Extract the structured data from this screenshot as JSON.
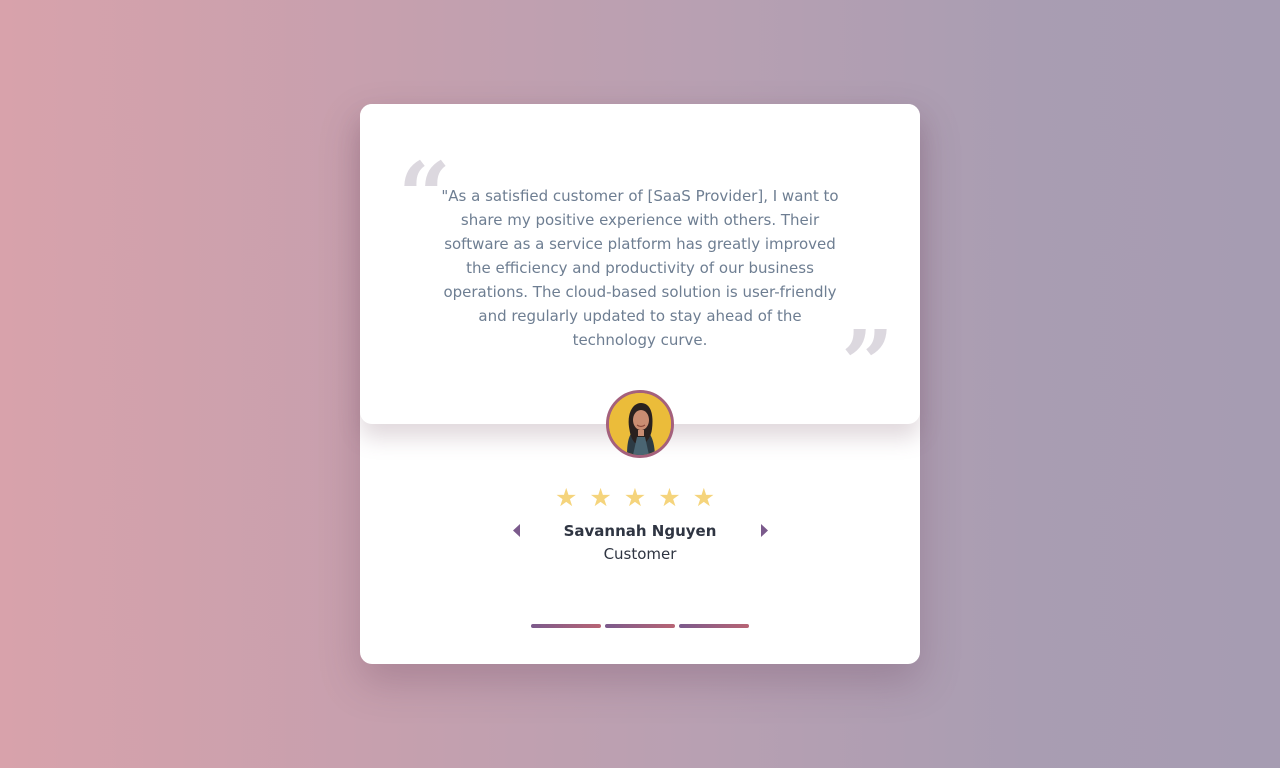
{
  "testimonial": {
    "quote_open": "“",
    "quote_close": "”",
    "text": "\"As a satisfied customer of [SaaS Provider], I want to share my positive experience with others. Their software as a service platform has greatly improved the efficiency and productivity of our business operations. The cloud-based solution is user-friendly and regularly updated to stay ahead of the technology curve.",
    "rating": 5,
    "star_glyph": "★",
    "name": "Savannah Nguyen",
    "role": "Customer"
  },
  "navigation": {
    "prev_icon": "caret-left-icon",
    "next_icon": "caret-right-icon"
  },
  "pagination": {
    "count": 3
  },
  "colors": {
    "star": "#f5d47c",
    "accent_start": "#7b5a8c",
    "accent_end": "#b86474",
    "avatar_border": "#a4607c"
  }
}
